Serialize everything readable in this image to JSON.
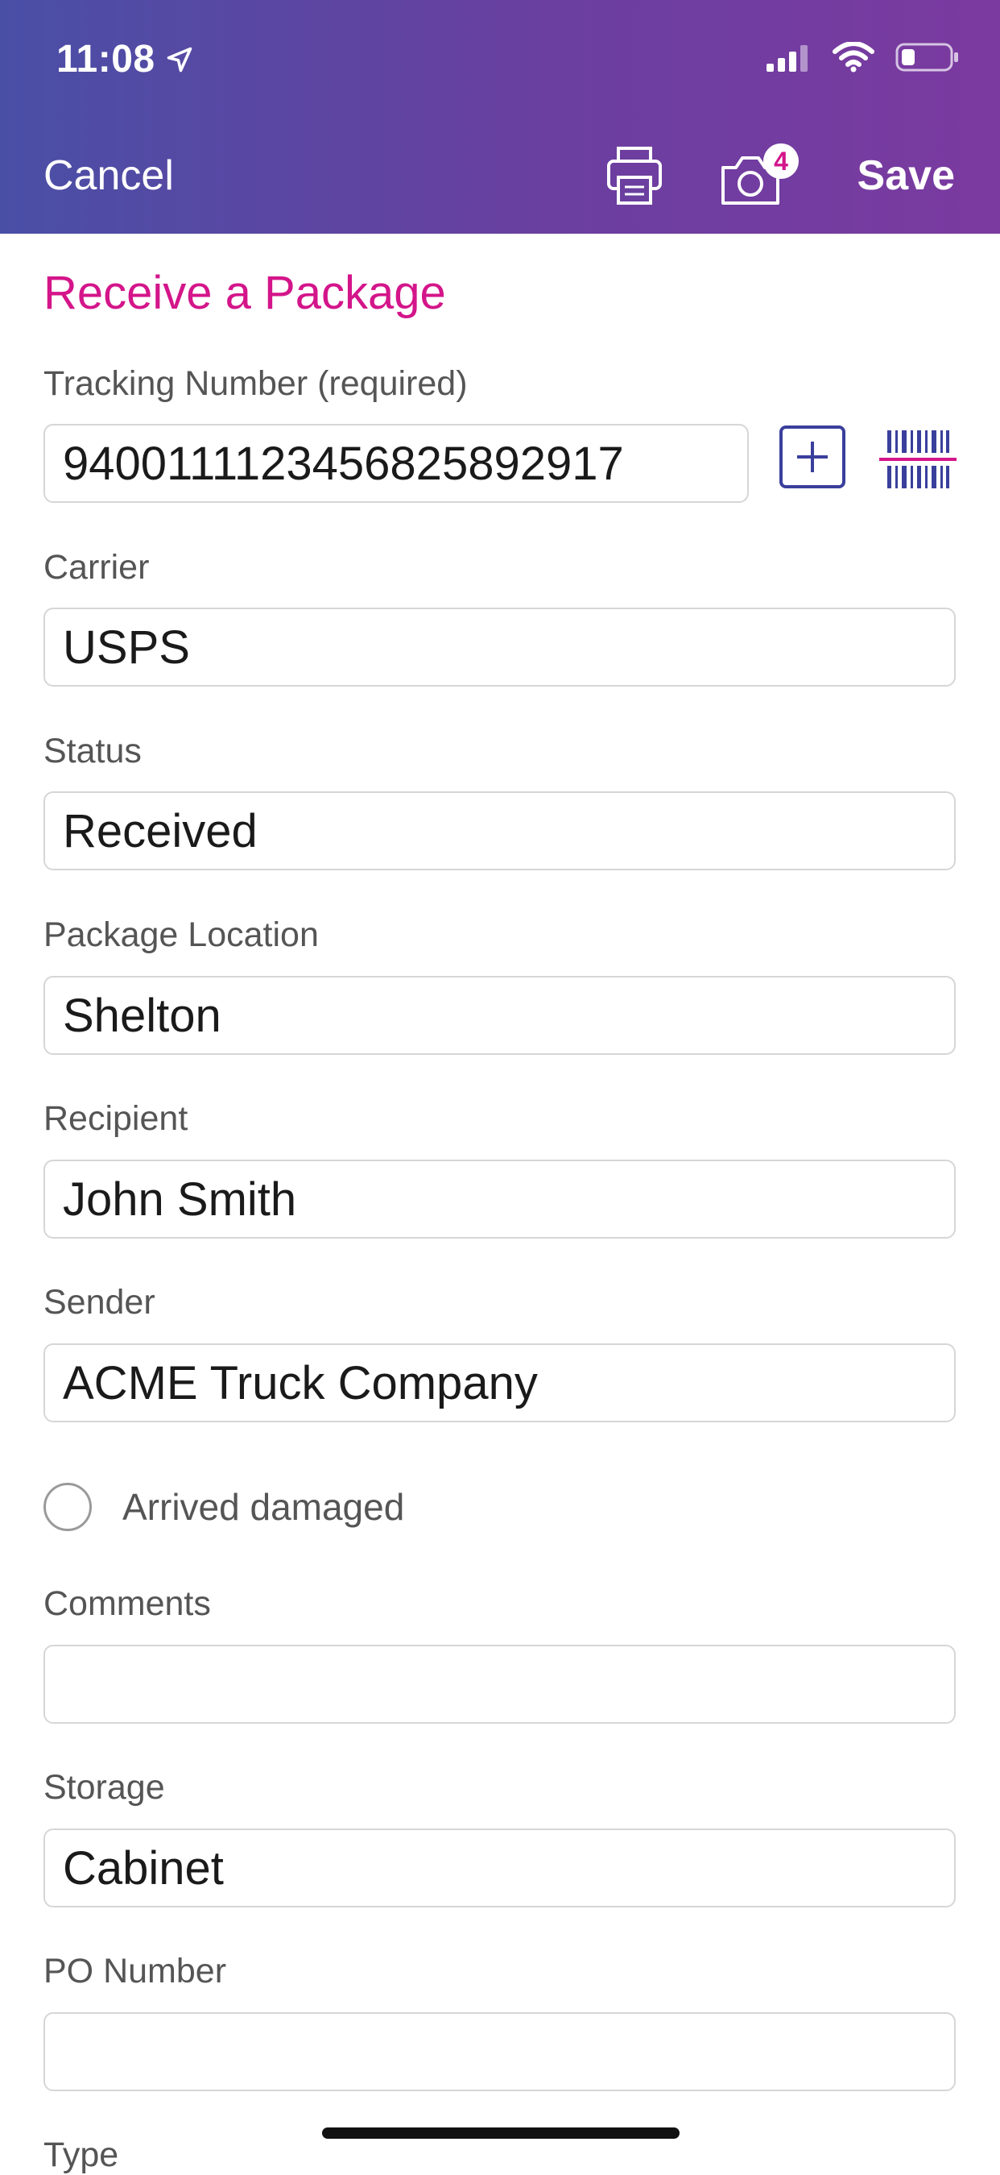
{
  "status_bar": {
    "time": "11:08"
  },
  "nav": {
    "cancel_label": "Cancel",
    "save_label": "Save",
    "photo_count": "4"
  },
  "colors": {
    "accent": "#d4158a",
    "brand_blue": "#3a3f9c",
    "header_start": "#4a4fa6",
    "header_end": "#7b3aa0"
  },
  "page_title": "Receive a Package",
  "fields": {
    "tracking": {
      "label": "Tracking Number (required)",
      "value": "9400111123456825892917"
    },
    "carrier": {
      "label": "Carrier",
      "value": "USPS"
    },
    "status": {
      "label": "Status",
      "value": "Received"
    },
    "location": {
      "label": "Package Location",
      "value": "Shelton"
    },
    "recipient": {
      "label": "Recipient",
      "value": "John Smith"
    },
    "sender": {
      "label": "Sender",
      "value": "ACME Truck Company"
    },
    "damaged": {
      "label": "Arrived damaged"
    },
    "comments": {
      "label": "Comments",
      "value": ""
    },
    "storage": {
      "label": "Storage",
      "value": "Cabinet"
    },
    "po_number": {
      "label": "PO Number",
      "value": ""
    },
    "type": {
      "label": "Type"
    }
  },
  "icons": {
    "location_arrow": "location-arrow-icon",
    "signal": "signal-icon",
    "wifi": "wifi-icon",
    "battery": "battery-icon",
    "print": "printer-icon",
    "camera": "camera-icon",
    "add": "plus-icon",
    "barcode": "barcode-scan-icon"
  }
}
